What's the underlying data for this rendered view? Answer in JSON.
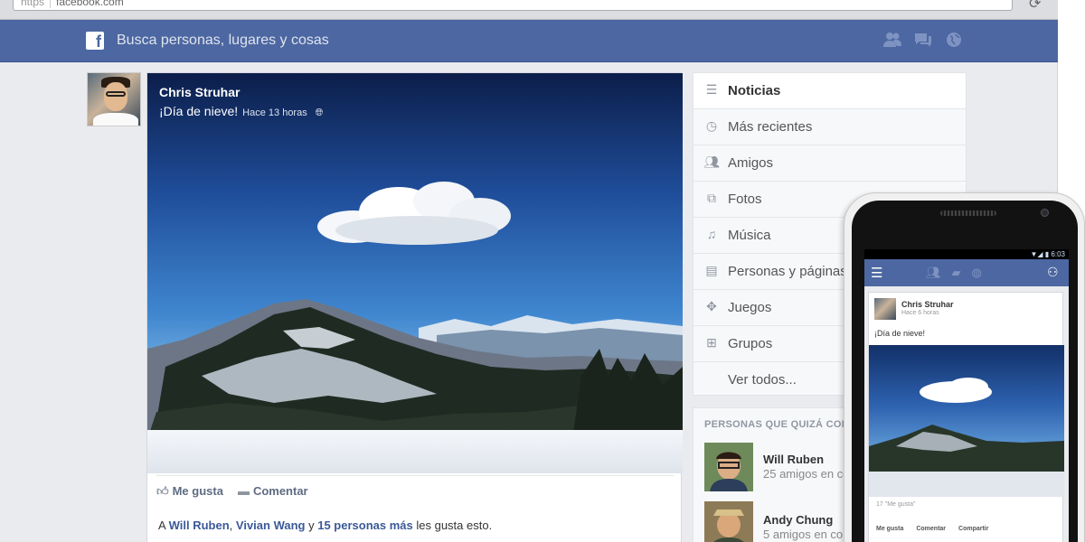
{
  "browser": {
    "url_protocol": "https",
    "url": "facebook.com"
  },
  "header": {
    "logo": "f",
    "search_placeholder": "Busca personas, lugares y cosas",
    "icons": [
      "friends-icon",
      "messages-icon",
      "notifications-globe-icon"
    ]
  },
  "post": {
    "author": "Chris Struhar",
    "status": "¡Día de nieve!",
    "time": "Hace 13 horas",
    "like_label": "Me gusta",
    "comment_label": "Comentar",
    "likes_prefix": "A",
    "likes_user1": "Will Ruben",
    "likes_sep": ",",
    "likes_user2": "Vivian Wang",
    "likes_and": "y",
    "likes_count": "15 personas más",
    "likes_suffix": "les gusta esto."
  },
  "nav": {
    "items": [
      {
        "label": "Noticias",
        "icon": "news-feed-icon"
      },
      {
        "label": "Más recientes",
        "icon": "clock-icon"
      },
      {
        "label": "Amigos",
        "icon": "friends-icon"
      },
      {
        "label": "Fotos",
        "icon": "photos-icon"
      },
      {
        "label": "Música",
        "icon": "music-icon"
      },
      {
        "label": "Personas y páginas",
        "icon": "pages-icon"
      },
      {
        "label": "Juegos",
        "icon": "games-icon"
      },
      {
        "label": "Grupos",
        "icon": "groups-icon"
      },
      {
        "label": "Ver todos...",
        "icon": ""
      }
    ]
  },
  "people": {
    "title": "PERSONAS QUE QUIZÁ CONOZCAS",
    "list": [
      {
        "name": "Will Ruben",
        "sub": "25 amigos en común"
      },
      {
        "name": "Andy Chung",
        "sub": "5 amigos en común"
      }
    ]
  },
  "phone": {
    "time": "6:03",
    "author": "Chris Struhar",
    "time_ago": "Hace 6 horas",
    "status": "¡Día de nieve!",
    "likes": "17 \"Me gusta\"",
    "like": "Me gusta",
    "comment": "Comentar",
    "share": "Compartir"
  }
}
